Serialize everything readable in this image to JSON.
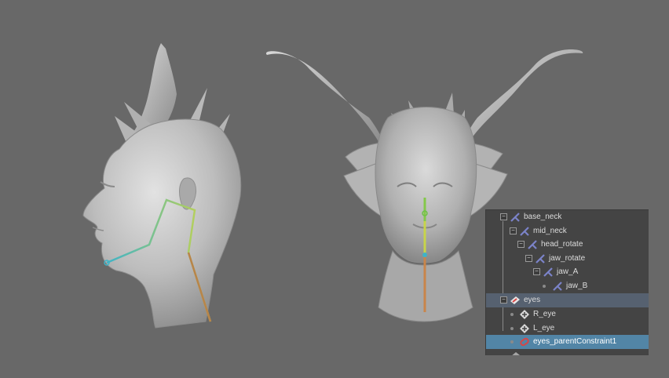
{
  "outliner": {
    "items": [
      {
        "label": "base_neck",
        "icon": "joint-icon"
      },
      {
        "label": "mid_neck",
        "icon": "joint-icon"
      },
      {
        "label": "head_rotate",
        "icon": "joint-icon"
      },
      {
        "label": "jaw_rotate",
        "icon": "joint-icon"
      },
      {
        "label": "jaw_A",
        "icon": "joint-icon"
      },
      {
        "label": "jaw_B",
        "icon": "joint-icon"
      },
      {
        "label": "eyes",
        "icon": "transform-group-icon"
      },
      {
        "label": "R_eye",
        "icon": "locator-icon"
      },
      {
        "label": "L_eye",
        "icon": "locator-icon"
      },
      {
        "label": "eyes_parentConstraint1",
        "icon": "parent-constraint-icon"
      }
    ]
  },
  "colors": {
    "viewport_bg": "#686868",
    "outliner_bg": "#444444",
    "selection": "#5285a6",
    "joint_icon": "#7b83c9",
    "constraint_icon": "#d84545"
  }
}
